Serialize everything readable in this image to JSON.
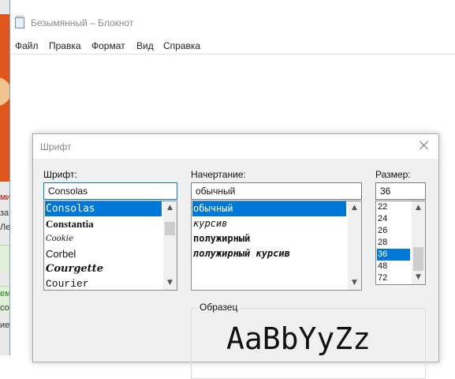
{
  "background_app": {
    "lines": [
      {
        "text": "ми",
        "color": "red"
      },
      {
        "text": "за",
        "color": "normal"
      },
      {
        "text": "Ле",
        "color": "normal"
      },
      {
        "text": "ем",
        "color": "green"
      },
      {
        "text": "со",
        "color": "normal"
      },
      {
        "text": "ие",
        "color": "normal"
      }
    ]
  },
  "notepad": {
    "title": "Безымянный – Блокнот",
    "menu": [
      "Файл",
      "Правка",
      "Формат",
      "Вид",
      "Справка"
    ]
  },
  "font_dialog": {
    "title": "Шрифт",
    "font": {
      "label": "Шрифт:",
      "value": "Consolas",
      "items": [
        "Consolas",
        "Constantia",
        "Cookie",
        "Corbel",
        "Courgette",
        "Courier"
      ],
      "selected": "Consolas"
    },
    "style": {
      "label": "Начертание:",
      "value": "обычный",
      "items": [
        "обычный",
        "курсив",
        "полужирный",
        "полужирный курсив"
      ],
      "selected": "обычный"
    },
    "size": {
      "label": "Размер:",
      "value": "36",
      "items": [
        "22",
        "24",
        "26",
        "28",
        "36",
        "48",
        "72"
      ],
      "selected": "36"
    },
    "sample": {
      "label": "Образец",
      "text": "AaBbYyZz"
    }
  },
  "colors": {
    "selection": "#0078d7",
    "dialog_bg": "#f0f0f0",
    "bg_app_orange": "#e0561c"
  }
}
